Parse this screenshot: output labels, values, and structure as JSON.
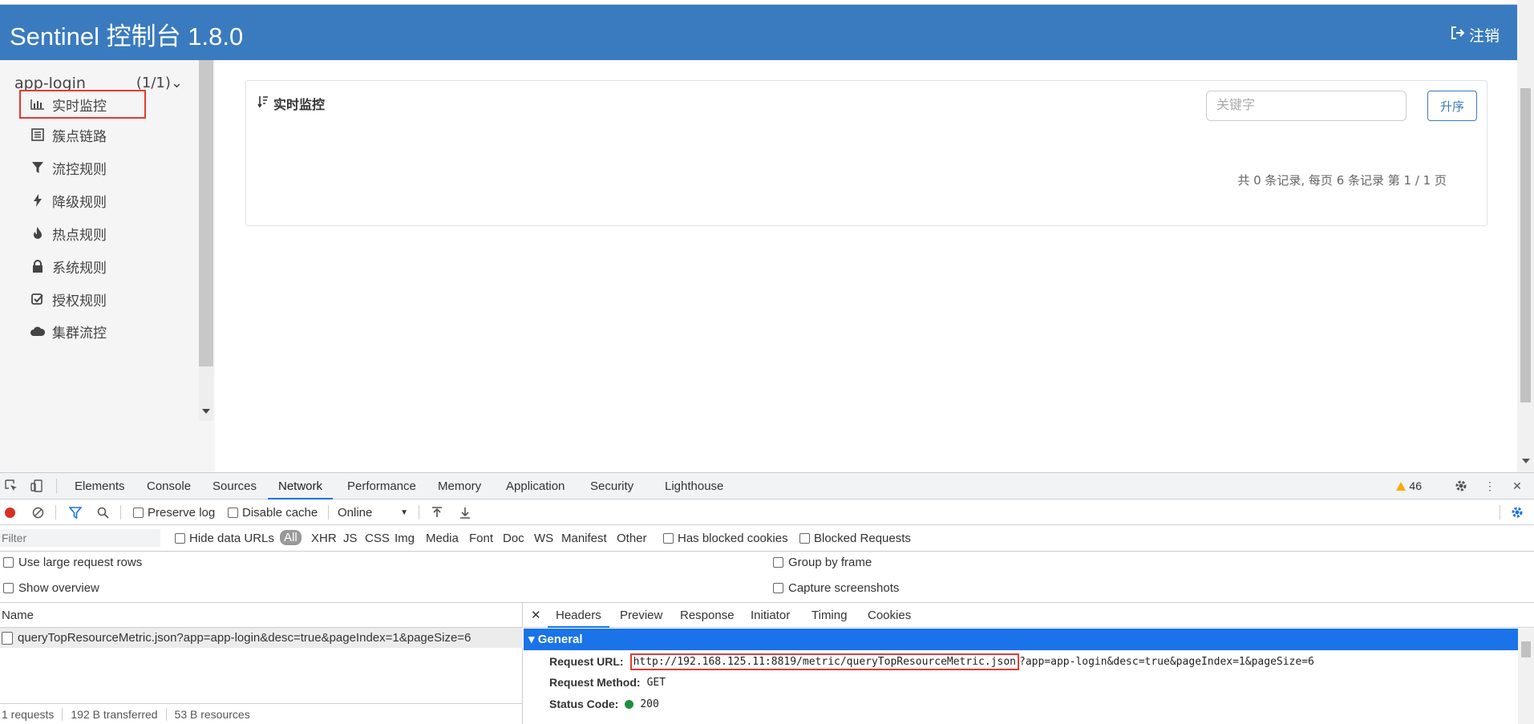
{
  "app": {
    "brand": "Sentinel 控制台 1.8.0",
    "logout": "注销"
  },
  "sidebar": {
    "app_name": "app-login",
    "app_count": "(1/1)",
    "items": [
      {
        "label": "实时监控",
        "icon": "bar-chart-icon"
      },
      {
        "label": "簇点链路",
        "icon": "list-icon"
      },
      {
        "label": "流控规则",
        "icon": "filter-icon"
      },
      {
        "label": "降级规则",
        "icon": "flash-icon"
      },
      {
        "label": "热点规则",
        "icon": "fire-icon"
      },
      {
        "label": "系统规则",
        "icon": "lock-icon"
      },
      {
        "label": "授权规则",
        "icon": "check-icon"
      },
      {
        "label": "集群流控",
        "icon": "cloud-icon"
      }
    ]
  },
  "panel": {
    "title": "实时监控",
    "search_placeholder": "关键字",
    "sort_button": "升序",
    "page_info": "共 0 条记录, 每页 6 条记录 第 1 / 1 页"
  },
  "devtools": {
    "tabs": [
      "Elements",
      "Console",
      "Sources",
      "Network",
      "Performance",
      "Memory",
      "Application",
      "Security",
      "Lighthouse"
    ],
    "active_tab": "Network",
    "warnings": "46",
    "toolbar": {
      "preserve_log": "Preserve log",
      "disable_cache": "Disable cache",
      "throttle": "Online"
    },
    "filter": {
      "placeholder": "Filter",
      "hide_data_urls": "Hide data URLs",
      "types": [
        "All",
        "XHR",
        "JS",
        "CSS",
        "Img",
        "Media",
        "Font",
        "Doc",
        "WS",
        "Manifest",
        "Other"
      ],
      "has_blocked_cookies": "Has blocked cookies",
      "blocked_requests": "Blocked Requests"
    },
    "options": {
      "large_rows": "Use large request rows",
      "show_overview": "Show overview",
      "group_by_frame": "Group by frame",
      "capture_screenshots": "Capture screenshots"
    },
    "requests": {
      "name_header": "Name",
      "rows": [
        "queryTopResourceMetric.json?app=app-login&desc=true&pageIndex=1&pageSize=6"
      ],
      "summary": [
        "1 requests",
        "192 B transferred",
        "53 B resources"
      ]
    },
    "detail": {
      "tabs": [
        "Headers",
        "Preview",
        "Response",
        "Initiator",
        "Timing",
        "Cookies"
      ],
      "active_tab": "Headers",
      "section": "General",
      "request_url_label": "Request URL:",
      "request_url_main": "http://192.168.125.11:8819/metric/queryTopResourceMetric.json",
      "request_url_query": "?app=app-login&desc=true&pageIndex=1&pageSize=6",
      "request_method_label": "Request Method:",
      "request_method": "GET",
      "status_code_label": "Status Code:",
      "status_code": "200"
    }
  },
  "colors": {
    "header_bg": "#3a7bbf",
    "highlight_border": "#e53935",
    "devtools_accent": "#1a73e8"
  }
}
